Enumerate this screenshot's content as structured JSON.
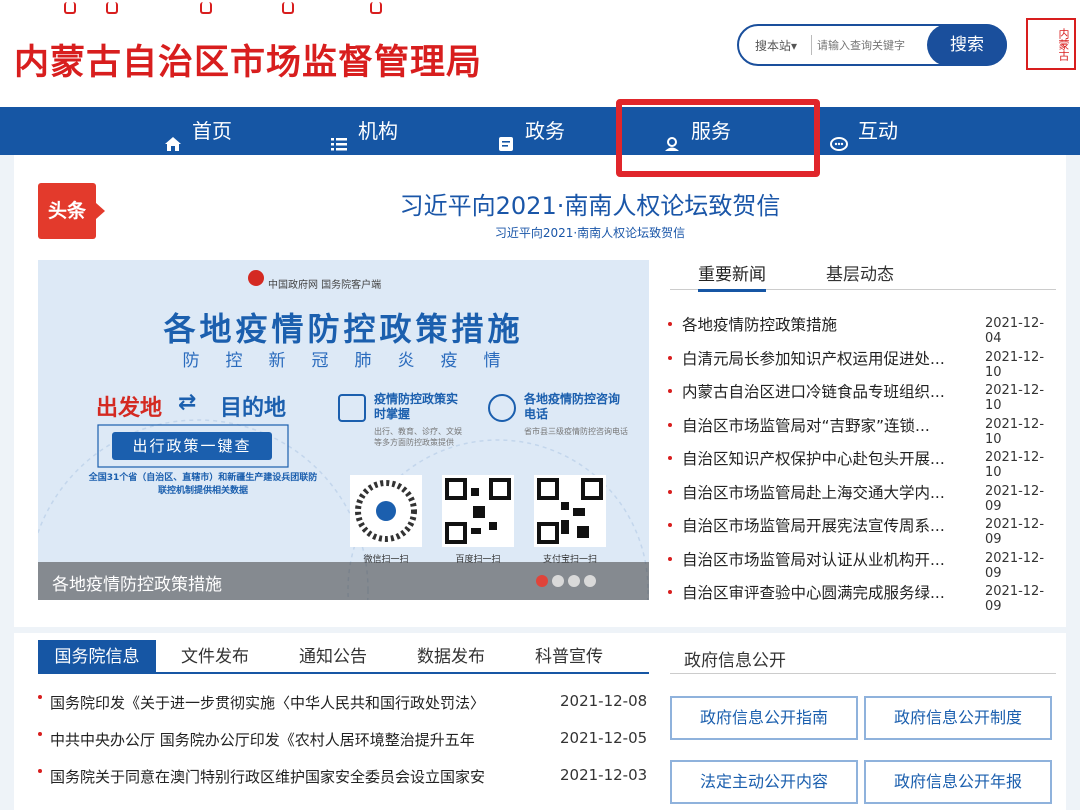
{
  "header": {
    "title": "内蒙古自治区市场监督管理局",
    "seal_text": "内蒙古"
  },
  "search": {
    "scope": "搜本站▾",
    "placeholder": "请输入查询关键字",
    "button": "搜索"
  },
  "nav": {
    "items": [
      {
        "label": "首页",
        "icon": "home-icon"
      },
      {
        "label": "机构",
        "icon": "list-icon"
      },
      {
        "label": "政务",
        "icon": "document-icon"
      },
      {
        "label": "服务",
        "icon": "service-icon"
      },
      {
        "label": "互动",
        "icon": "chat-icon"
      }
    ]
  },
  "headline": {
    "badge": "头条",
    "title": "习近平向2021·南南人权论坛致贺信",
    "subtitle": "习近平向2021·南南人权论坛致贺信"
  },
  "banner": {
    "gov_logo_text": "中国政府网  国务院客户端",
    "title": "各地疫情防控政策措施",
    "subtitle": "防控新冠肺炎疫情",
    "from": "出发地",
    "to": "目的地",
    "button": "出行政策一键查",
    "note": "全国31个省（自治区、直辖市）和新疆生产建设兵团联防联控机制提供相关数据",
    "feature1_title": "疫情防控政策实时掌握",
    "feature1_desc": "出行、教育、诊疗、文娱等多方面防控政策提供",
    "feature2_title": "各地疫情防控咨询电话",
    "feature2_desc": "省市县三级疫情防控咨询电话",
    "qr_labels": [
      "微信扫一扫",
      "百度扫一扫",
      "支付宝扫一扫"
    ],
    "caption": "各地疫情防控政策措施"
  },
  "news": {
    "tabs": [
      "重要新闻",
      "基层动态"
    ],
    "items": [
      {
        "title": "各地疫情防控政策措施",
        "date": "2021-12-04"
      },
      {
        "title": "白清元局长参加知识产权运用促进处...",
        "date": "2021-12-10"
      },
      {
        "title": "内蒙古自治区进口冷链食品专班组织...",
        "date": "2021-12-10"
      },
      {
        "title": "自治区市场监管局对“吉野家”连锁...",
        "date": "2021-12-10"
      },
      {
        "title": "自治区知识产权保护中心赴包头开展...",
        "date": "2021-12-10"
      },
      {
        "title": "自治区市场监管局赴上海交通大学内...",
        "date": "2021-12-09"
      },
      {
        "title": "自治区市场监管局开展宪法宣传周系...",
        "date": "2021-12-09"
      },
      {
        "title": "自治区市场监管局对认证从业机构开...",
        "date": "2021-12-09"
      },
      {
        "title": "自治区审评查验中心圆满完成服务绿...",
        "date": "2021-12-09"
      }
    ]
  },
  "bottom": {
    "tabs": [
      "国务院信息",
      "文件发布",
      "通知公告",
      "数据发布",
      "科普宣传"
    ],
    "items": [
      {
        "title": "国务院印发《关于进一步贯彻实施〈中华人民共和国行政处罚法〉",
        "date": "2021-12-08"
      },
      {
        "title": "中共中央办公厅 国务院办公厅印发《农村人居环境整治提升五年",
        "date": "2021-12-05"
      },
      {
        "title": "国务院关于同意在澳门特别行政区维护国家安全委员会设立国家安",
        "date": "2021-12-03"
      }
    ]
  },
  "gov_info": {
    "title": "政府信息公开",
    "buttons": [
      "政府信息公开指南",
      "政府信息公开制度",
      "法定主动公开内容",
      "政府信息公开年报"
    ]
  },
  "colors": {
    "brand_red": "#d81e1e",
    "nav_blue": "#1656a4",
    "highlight_red": "#e0262b"
  }
}
